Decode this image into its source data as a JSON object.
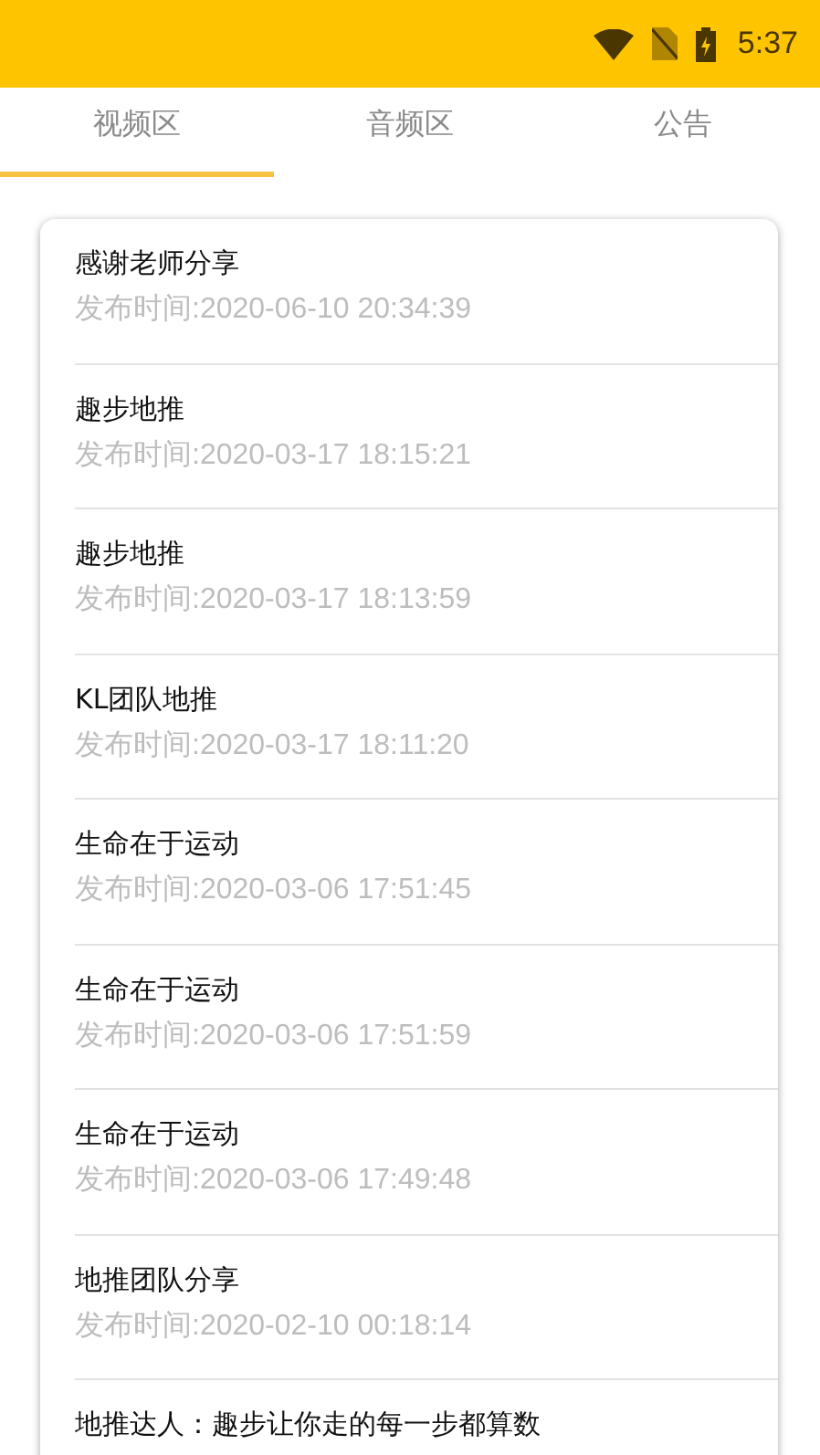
{
  "status_bar": {
    "time": "5:37"
  },
  "tabs": [
    {
      "label": "视频区",
      "selected": true
    },
    {
      "label": "音频区",
      "selected": false
    },
    {
      "label": "公告",
      "selected": false
    }
  ],
  "posts": [
    {
      "title": "感谢老师分享",
      "time": "发布时间:2020-06-10 20:34:39"
    },
    {
      "title": "趣步地推",
      "time": "发布时间:2020-03-17 18:15:21"
    },
    {
      "title": "趣步地推",
      "time": "发布时间:2020-03-17 18:13:59"
    },
    {
      "title": "KL团队地推",
      "time": "发布时间:2020-03-17 18:11:20"
    },
    {
      "title": "生命在于运动",
      "time": "发布时间:2020-03-06 17:51:45"
    },
    {
      "title": "生命在于运动",
      "time": "发布时间:2020-03-06 17:51:59"
    },
    {
      "title": "生命在于运动",
      "time": "发布时间:2020-03-06 17:49:48"
    },
    {
      "title": "地推团队分享",
      "time": "发布时间:2020-02-10 00:18:14"
    },
    {
      "title": "地推达人：趣步让你走的每一步都算数"
    }
  ]
}
